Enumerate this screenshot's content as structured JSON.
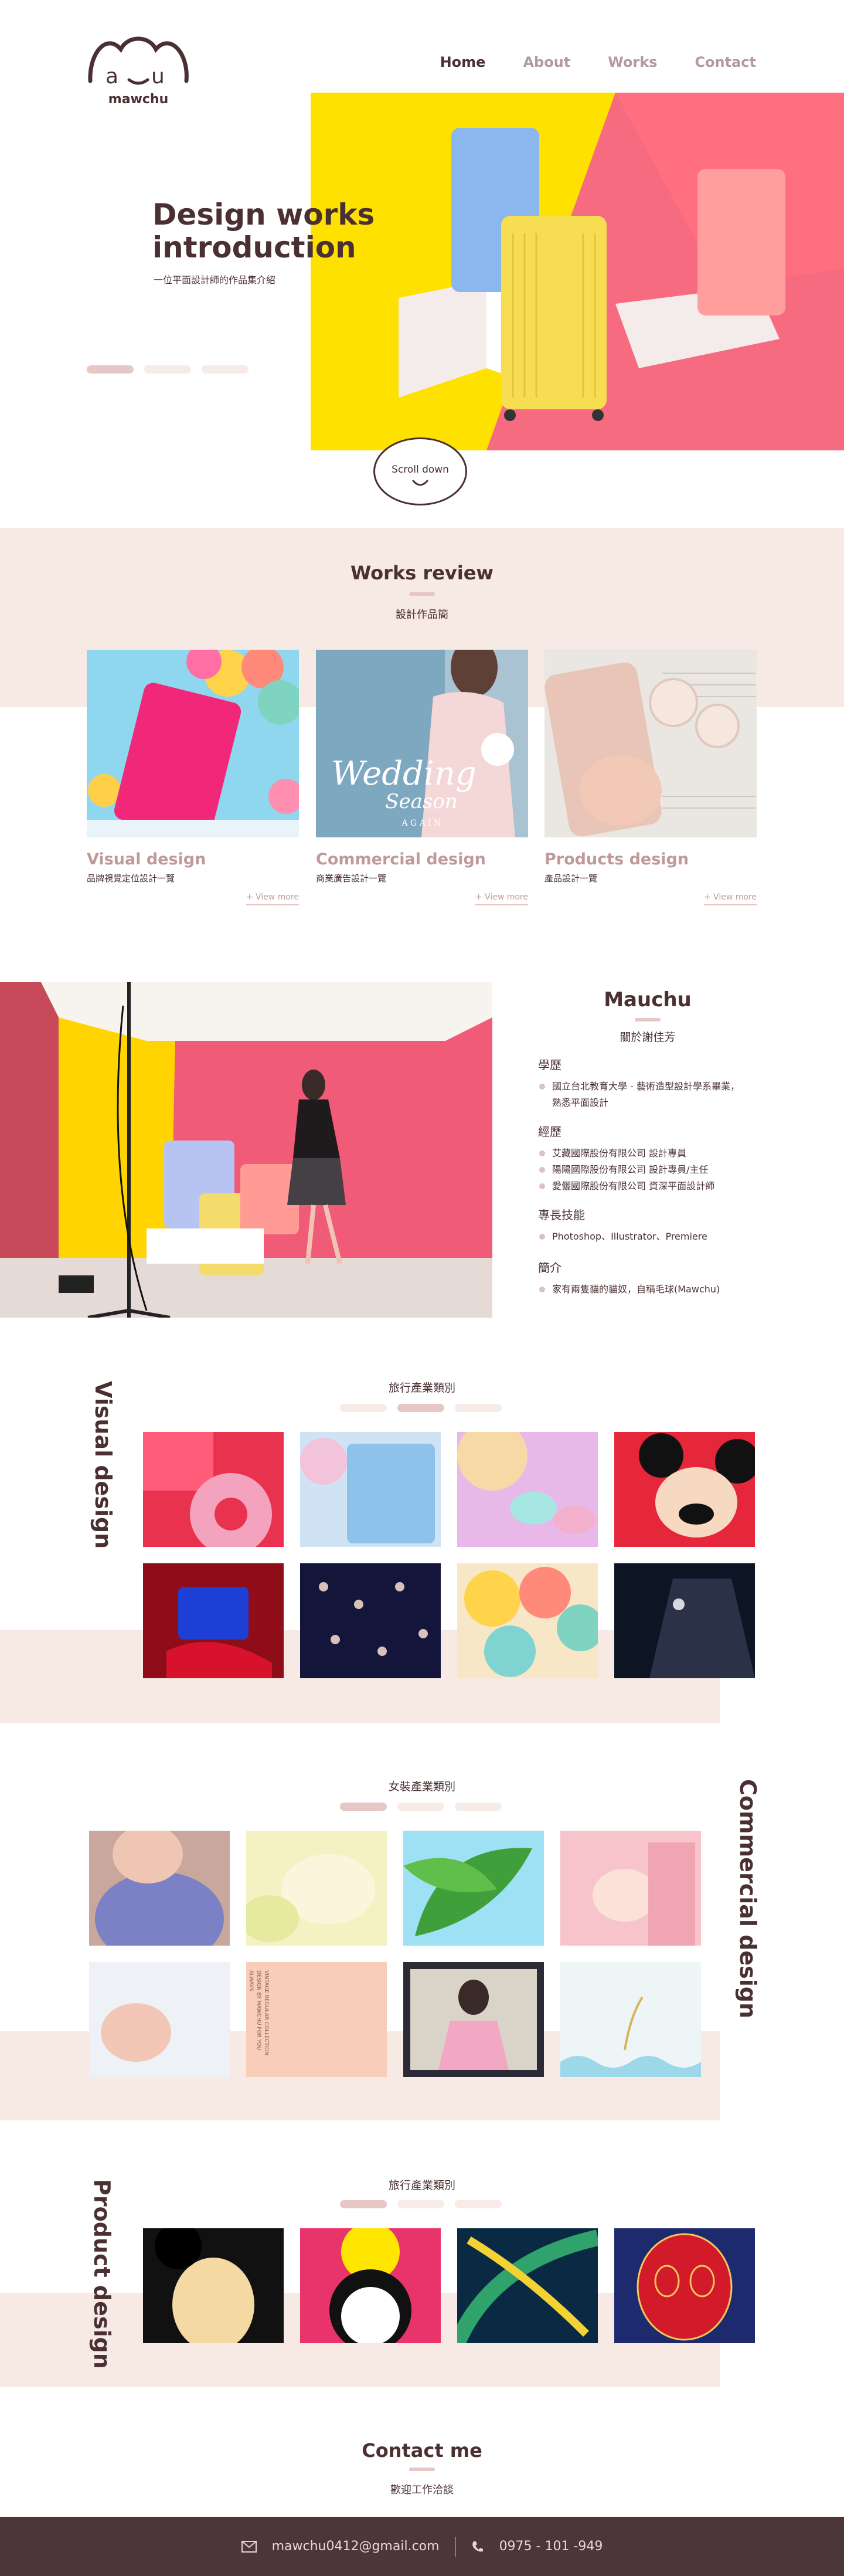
{
  "nav": {
    "brand": "mawchu",
    "items": [
      "Home",
      "About",
      "Works",
      "Contact"
    ]
  },
  "hero": {
    "title_1": "Design works",
    "title_2": "introduction",
    "subtitle": "一位平面設計師的作品集介紹",
    "scroll": "Scroll down"
  },
  "works": {
    "title": "Works review",
    "subtitle": "設計作品簡",
    "cards": [
      {
        "title": "Visual design",
        "sub": "品牌視覺定位設計一覽",
        "more": "+ View more"
      },
      {
        "title": "Commercial design",
        "sub": "商業廣告設計一覽",
        "more": "+ View more",
        "overlay_1": "Wedding",
        "overlay_2": "Season",
        "overlay_3": "A G A I N"
      },
      {
        "title": "Products design",
        "sub": "產品設計一覽",
        "more": "+ View more"
      }
    ]
  },
  "about": {
    "name": "Mauchu",
    "sub": "關於謝佳芳",
    "edu_h": "學歷",
    "edu": [
      "國立台北教育大學 - 藝術造型設計學系畢業，",
      "熟悉平面設計"
    ],
    "exp_h": "經歷",
    "exp": [
      "艾藏國際股份有限公司 設計專員",
      "陽陽國際股份有限公司 設計專員/主任",
      "愛儷國際股份有限公司 資深平面設計師"
    ],
    "skill_h": "專長技能",
    "skill": [
      "Photoshop、Illustrator、Premiere"
    ],
    "intro_h": "簡介",
    "intro": [
      "家有兩隻貓的貓奴，自稱毛球(Mawchu)"
    ]
  },
  "visual": {
    "label": "Visual design",
    "caption": "旅行產業類別"
  },
  "commercial": {
    "label": "Commercial design",
    "caption": "女裝產業類別",
    "poster": "VINTAGE REGULAR COLLECTION DESIGN BY MAWCHU FOR YOU ALWAYS"
  },
  "product": {
    "label": "Product design",
    "caption": "旅行產業類別"
  },
  "contact": {
    "title": "Contact me",
    "sub": "歡迎工作洽談",
    "email": "mawchu0412@gmail.com",
    "phone": "0975 - 101 -949"
  }
}
